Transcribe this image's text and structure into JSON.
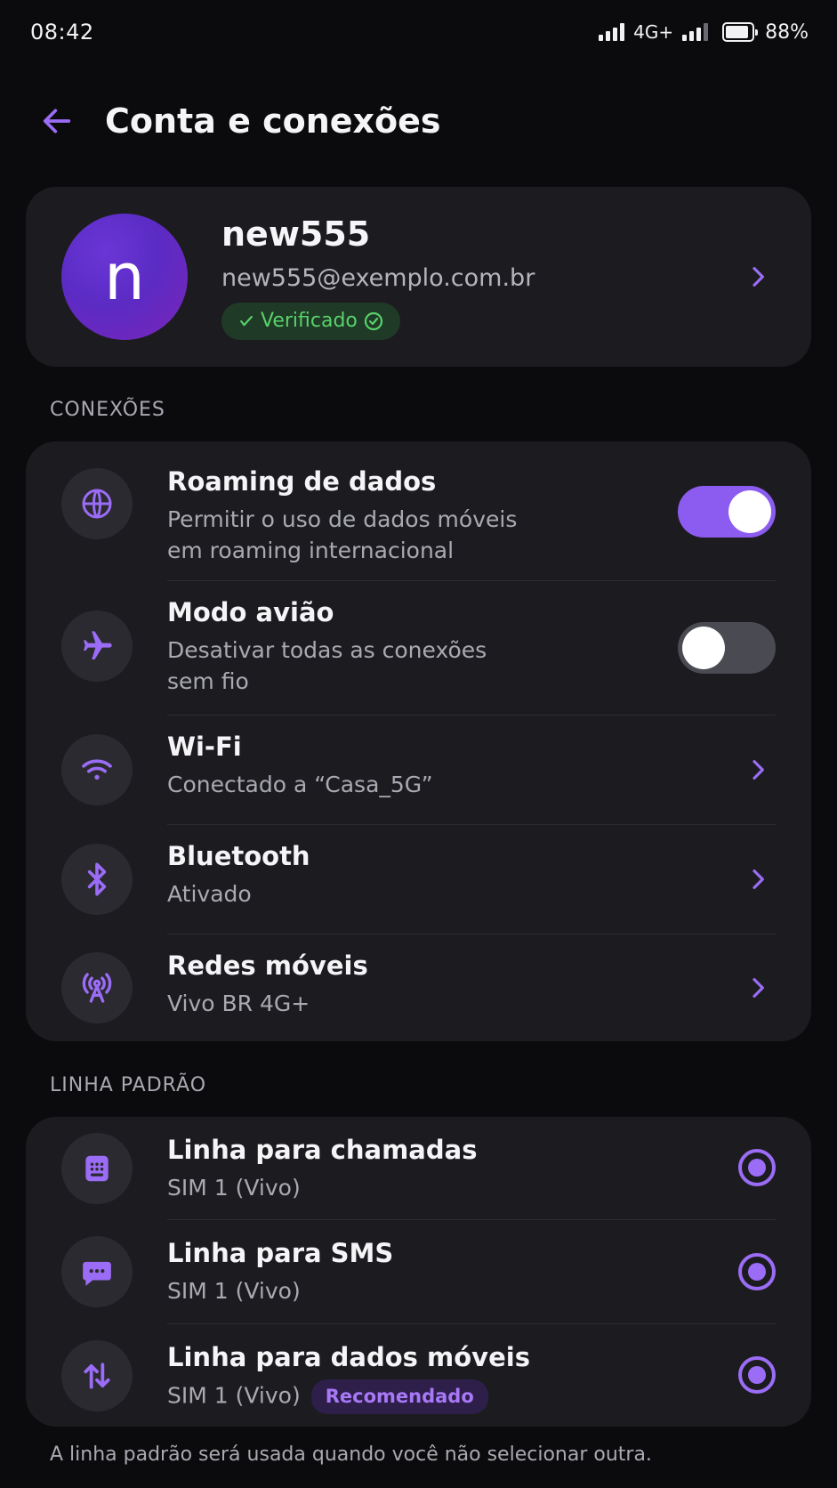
{
  "status_bar": {
    "time": "08:42",
    "network": "4G+",
    "battery": "88%",
    "battery_level": 0.88
  },
  "header": {
    "title": "Conta e conexões",
    "back_icon": "arrow-left-icon"
  },
  "profile": {
    "initial": "n",
    "name": "new555",
    "email": "new555@exemplo.com.br",
    "badge": "Verificado"
  },
  "sections": {
    "connections_label": "CONEXÕES",
    "default_line_label": "LINHA PADRÃO"
  },
  "connections": [
    {
      "title": "Roaming de dados",
      "subtitle_line1": "Permitir o uso de dados móveis",
      "subtitle_line2": "em roaming internacional",
      "icon": "globe-icon",
      "control": "toggle",
      "on": true
    },
    {
      "title": "Modo avião",
      "subtitle_line1": "Desativar todas as conexões",
      "subtitle_line2": "sem fio",
      "icon": "airplane-icon",
      "control": "toggle",
      "on": false
    },
    {
      "title": "Wi-Fi",
      "subtitle_line1": "Conectado a “Casa_5G”",
      "icon": "wifi-icon",
      "control": "chevron"
    },
    {
      "title": "Bluetooth",
      "subtitle_line1": "Ativado",
      "icon": "bluetooth-icon",
      "control": "chevron"
    },
    {
      "title": "Redes móveis",
      "subtitle_line1": "Vivo BR 4G+",
      "icon": "cell-tower-icon",
      "control": "chevron"
    }
  ],
  "default_lines": [
    {
      "title": "Linha para chamadas",
      "subtitle": "SIM 1 (Vivo)",
      "icon": "dialpad-icon",
      "selected": true
    },
    {
      "title": "Linha para SMS",
      "subtitle": "SIM 1 (Vivo)",
      "icon": "chat-icon",
      "selected": true
    },
    {
      "title": "Linha para dados móveis",
      "subtitle": "SIM 1 (Vivo)",
      "badge": "Recomendado",
      "icon": "data-transfer-icon",
      "selected": true
    }
  ],
  "footer": {
    "note": "A linha padrão será usada quando você não selecionar outra."
  },
  "colors": {
    "accent": "#9b6cf5",
    "toggle_on": "#8c5cf0",
    "verified_text": "#59d16a",
    "background": "#0b0b0d",
    "card": "#1c1c20"
  }
}
